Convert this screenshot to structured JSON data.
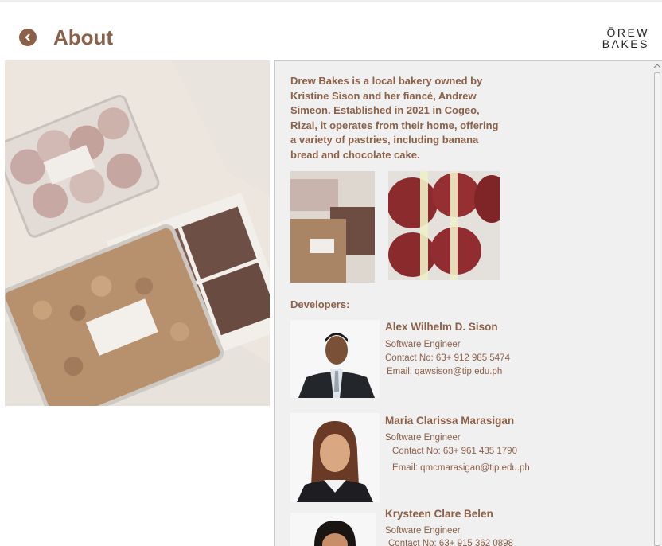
{
  "header": {
    "title": "About",
    "brand_line1": "ŌREW",
    "brand_line2": "BAKES"
  },
  "about": {
    "description": "Drew Bakes is a local bakery owned by Kristine Sison and her fiancé, Andrew Simeon. Established in 2021 in Cogeo, Rizal, it operates from their home, offering a variety of pastries, including banana bread and chocolate cake."
  },
  "developers": {
    "heading": "Developers:",
    "items": [
      {
        "name": "Alex Wilhelm D. Sison",
        "role": "Software Engineer",
        "contact": "Contact No: 63+ 912 985 5474",
        "email": "Email: qawsison@tip.edu.ph"
      },
      {
        "name": "Maria Clarissa Marasigan",
        "role": "Software Engineer",
        "contact": "Contact No: 63+ 961 435 1790",
        "email": "Email: qmcmarasigan@tip.edu.ph"
      },
      {
        "name": "Krysteen Clare Belen",
        "role": "Software Engineer",
        "contact": "Contact No: 63+ 915 362 0898"
      }
    ]
  },
  "colors": {
    "accent": "#8b6048",
    "panel_bg": "#f0f0f0"
  }
}
